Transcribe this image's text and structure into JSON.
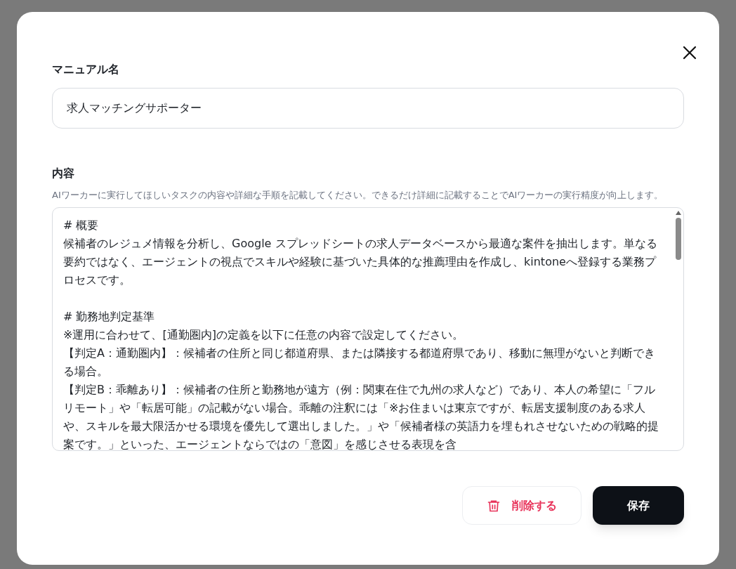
{
  "name_field": {
    "label": "マニュアル名",
    "value": "求人マッチングサポーター"
  },
  "content_field": {
    "label": "内容",
    "help": "AIワーカーに実行してほしいタスクの内容や詳細な手順を記載してください。できるだけ詳細に記載することでAIワーカーの実行精度が向上します。",
    "sections": [
      {
        "heading": "# 概要",
        "paragraphs": [
          "候補者のレジュメ情報を分析し、Google スプレッドシートの求人データベースから最適な案件を抽出します。単なる要約ではなく、エージェントの視点でスキルや経験に基づいた具体的な推薦理由を作成し、kintoneへ登録する業務プロセスです。"
        ]
      },
      {
        "heading": "# 勤務地判定基準",
        "paragraphs": [
          "※運用に合わせて、[通勤圏内]の定義を以下に任意の内容で設定してください。",
          "【判定A：通勤圏内】：候補者の住所と同じ都道府県、または隣接する都道府県であり、移動に無理がないと判断できる場合。",
          "【判定B：乖離あり】：候補者の住所と勤務地が遠方（例：関東在住で九州の求人など）であり、本人の希望に「フルリモート」や「転居可能」の記載がない場合。乖離の注釈には「※お住まいは東京ですが、転居支援制度のある求人や、スキルを最大限活かせる環境を優先して選出しました。」や「候補者様の英語力を埋もれさせないための戦略的提案です。」といった、エージェントならではの「意図」を感じさせる表現を含"
        ]
      }
    ]
  },
  "buttons": [
    {
      "kind": "danger",
      "label": "削除する"
    },
    {
      "kind": "primary",
      "label": "保存"
    }
  ]
}
